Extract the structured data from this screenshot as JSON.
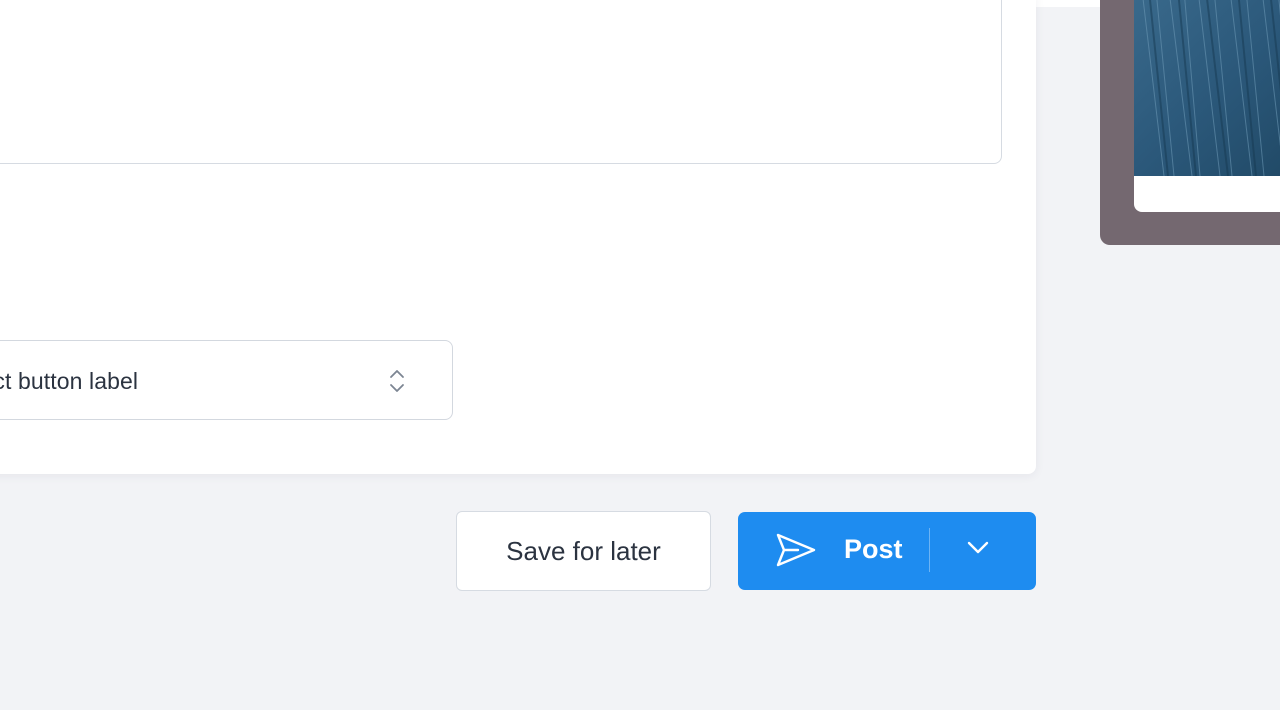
{
  "composer": {
    "message_value": ""
  },
  "button_label_select": {
    "selected_value": "Select button label"
  },
  "actions": {
    "save_label": "Save for later",
    "post_label": "Post"
  },
  "icons": {
    "post": "send-icon",
    "post_menu": "chevron-down-icon",
    "select": "chevron-up-down-icon"
  },
  "colors": {
    "primary": "#1e8cf0",
    "page_background": "#f2f3f6",
    "preview_frame": "#746870",
    "preview_image": "#2d5877"
  }
}
